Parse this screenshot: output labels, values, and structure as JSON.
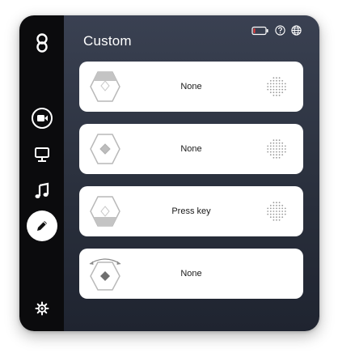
{
  "header": {
    "title": "Custom",
    "icons": [
      "battery-icon",
      "help-icon",
      "globe-icon"
    ],
    "battery_level": 0.15
  },
  "sidebar": {
    "items": [
      {
        "name": "logo-icon",
        "active": false
      },
      {
        "name": "video-icon",
        "active": false
      },
      {
        "name": "presentation-icon",
        "active": false
      },
      {
        "name": "music-icon",
        "active": false
      },
      {
        "name": "pencil-icon",
        "active": true
      },
      {
        "name": "settings-gear-icon",
        "active": false
      }
    ]
  },
  "cards": [
    {
      "label": "None",
      "icon": "dial-top-button-icon"
    },
    {
      "label": "None",
      "icon": "dial-center-button-icon"
    },
    {
      "label": "Press key",
      "icon": "dial-bottom-button-icon"
    },
    {
      "label": "None",
      "icon": "dial-rotate-icon"
    }
  ],
  "colors": {
    "sidebar": "#0b0b0d",
    "main_top": "#3a4152",
    "main_bottom": "#1f2430",
    "battery_low": "#e23b3b"
  }
}
